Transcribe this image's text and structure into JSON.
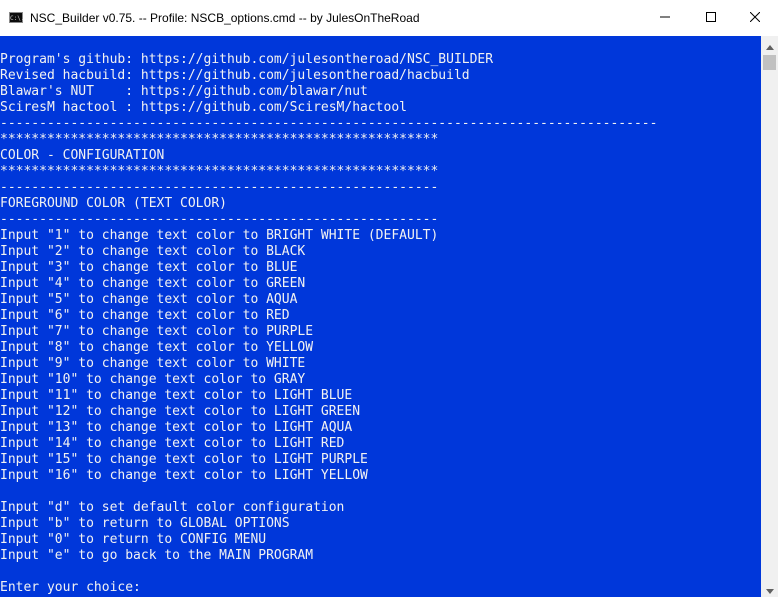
{
  "window": {
    "title": "NSC_Builder v0.75. -- Profile: NSCB_options.cmd -- by JulesOnTheRoad",
    "icon_text": "C:\\.",
    "app_icon": "console-icon"
  },
  "titlebar_buttons": [
    {
      "name": "minimize-button",
      "icon": "minimize-icon"
    },
    {
      "name": "maximize-button",
      "icon": "maximize-icon"
    },
    {
      "name": "close-button",
      "icon": "close-icon"
    }
  ],
  "colors": {
    "console_background": "#0037da",
    "console_text": "#f2f2f2",
    "titlebar": "#ffffff",
    "scrollbar_track": "#f0f0f0",
    "scrollbar_thumb": "#c1c1c1"
  },
  "console": {
    "lines": [
      "Program's github: https://github.com/julesontheroad/NSC_BUILDER",
      "Revised hacbuild: https://github.com/julesontheroad/hacbuild",
      "Blawar's NUT    : https://github.com/blawar/nut",
      "SciresM hactool : https://github.com/SciresM/hactool",
      "------------------------------------------------------------------------------------",
      "********************************************************",
      "COLOR - CONFIGURATION",
      "********************************************************",
      "--------------------------------------------------------",
      "FOREGROUND COLOR (TEXT COLOR)",
      "--------------------------------------------------------",
      "Input \"1\" to change text color to BRIGHT WHITE (DEFAULT)",
      "Input \"2\" to change text color to BLACK",
      "Input \"3\" to change text color to BLUE",
      "Input \"4\" to change text color to GREEN",
      "Input \"5\" to change text color to AQUA",
      "Input \"6\" to change text color to RED",
      "Input \"7\" to change text color to PURPLE",
      "Input \"8\" to change text color to YELLOW",
      "Input \"9\" to change text color to WHITE",
      "Input \"10\" to change text color to GRAY",
      "Input \"11\" to change text color to LIGHT BLUE",
      "Input \"12\" to change text color to LIGHT GREEN",
      "Input \"13\" to change text color to LIGHT AQUA",
      "Input \"14\" to change text color to LIGHT RED",
      "Input \"15\" to change text color to LIGHT PURPLE",
      "Input \"16\" to change text color to LIGHT YELLOW",
      "",
      "Input \"d\" to set default color configuration",
      "Input \"b\" to return to GLOBAL OPTIONS",
      "Input \"0\" to return to CONFIG MENU",
      "Input \"e\" to go back to the MAIN PROGRAM",
      "",
      "Enter your choice:"
    ]
  },
  "scrollbar": {
    "up_icon": "scroll-up-arrow-icon",
    "down_icon": "scroll-down-arrow-icon",
    "position": 0
  }
}
